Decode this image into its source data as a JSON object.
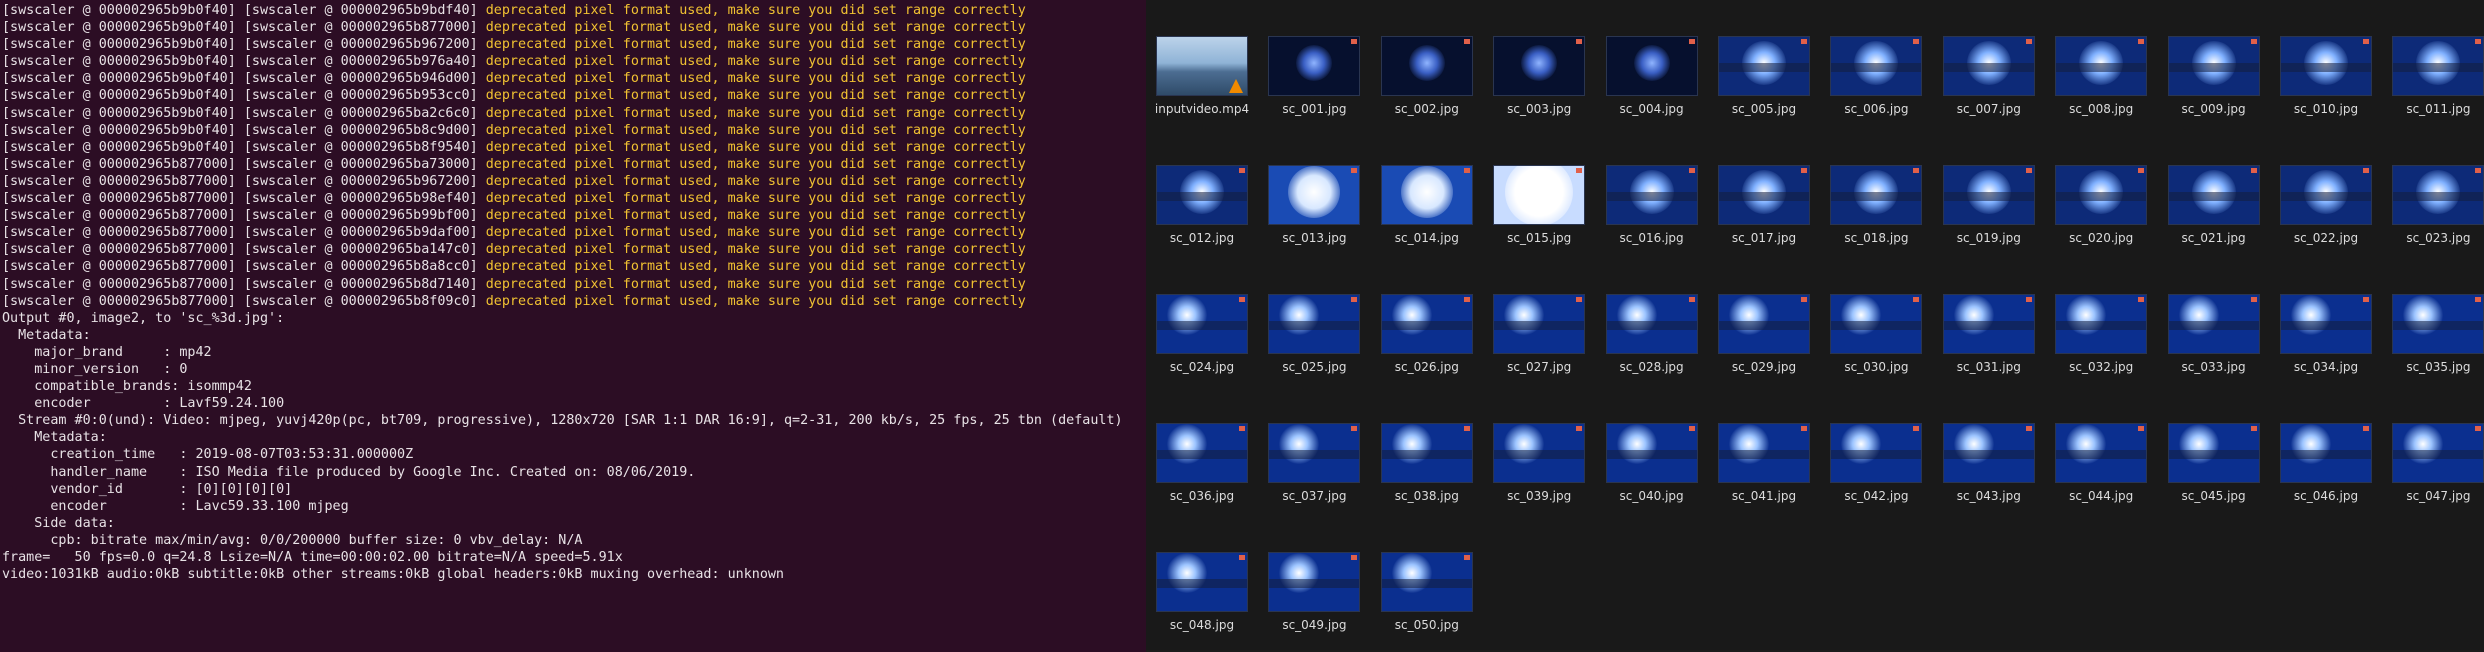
{
  "terminal": {
    "lines": [
      {
        "pre": "[swscaler @ 000002965b9b0f40] [swscaler @ 000002965b9bdf40] ",
        "msg": "deprecated pixel format used, make sure you did set range correctly"
      },
      {
        "pre": "[swscaler @ 000002965b9b0f40] [swscaler @ 000002965b877000] ",
        "msg": "deprecated pixel format used, make sure you did set range correctly"
      },
      {
        "pre": "[swscaler @ 000002965b9b0f40] [swscaler @ 000002965b967200] ",
        "msg": "deprecated pixel format used, make sure you did set range correctly"
      },
      {
        "pre": "[swscaler @ 000002965b9b0f40] [swscaler @ 000002965b976a40] ",
        "msg": "deprecated pixel format used, make sure you did set range correctly"
      },
      {
        "pre": "[swscaler @ 000002965b9b0f40] [swscaler @ 000002965b946d00] ",
        "msg": "deprecated pixel format used, make sure you did set range correctly"
      },
      {
        "pre": "[swscaler @ 000002965b9b0f40] [swscaler @ 000002965b953cc0] ",
        "msg": "deprecated pixel format used, make sure you did set range correctly"
      },
      {
        "pre": "[swscaler @ 000002965b9b0f40] [swscaler @ 000002965ba2c6c0] ",
        "msg": "deprecated pixel format used, make sure you did set range correctly"
      },
      {
        "pre": "[swscaler @ 000002965b9b0f40] [swscaler @ 000002965b8c9d00] ",
        "msg": "deprecated pixel format used, make sure you did set range correctly"
      },
      {
        "pre": "[swscaler @ 000002965b9b0f40] [swscaler @ 000002965b8f9540] ",
        "msg": "deprecated pixel format used, make sure you did set range correctly"
      },
      {
        "pre": "[swscaler @ 000002965b877000] [swscaler @ 000002965ba73000] ",
        "msg": "deprecated pixel format used, make sure you did set range correctly"
      },
      {
        "pre": "[swscaler @ 000002965b877000] [swscaler @ 000002965b967200] ",
        "msg": "deprecated pixel format used, make sure you did set range correctly"
      },
      {
        "pre": "[swscaler @ 000002965b877000] [swscaler @ 000002965b98ef40] ",
        "msg": "deprecated pixel format used, make sure you did set range correctly"
      },
      {
        "pre": "[swscaler @ 000002965b877000] [swscaler @ 000002965b99bf00] ",
        "msg": "deprecated pixel format used, make sure you did set range correctly"
      },
      {
        "pre": "[swscaler @ 000002965b877000] [swscaler @ 000002965b9daf00] ",
        "msg": "deprecated pixel format used, make sure you did set range correctly"
      },
      {
        "pre": "[swscaler @ 000002965b877000] [swscaler @ 000002965ba147c0] ",
        "msg": "deprecated pixel format used, make sure you did set range correctly"
      },
      {
        "pre": "[swscaler @ 000002965b877000] [swscaler @ 000002965b8a8cc0] ",
        "msg": "deprecated pixel format used, make sure you did set range correctly"
      },
      {
        "pre": "[swscaler @ 000002965b877000] [swscaler @ 000002965b8d7140] ",
        "msg": "deprecated pixel format used, make sure you did set range correctly"
      },
      {
        "pre": "[swscaler @ 000002965b877000] [swscaler @ 000002965b8f09c0] ",
        "msg": "deprecated pixel format used, make sure you did set range correctly"
      },
      {
        "pre": "Output #0, image2, to 'sc_%3d.jpg':",
        "msg": ""
      },
      {
        "pre": "  Metadata:",
        "msg": ""
      },
      {
        "pre": "    major_brand     : mp42",
        "msg": ""
      },
      {
        "pre": "    minor_version   : 0",
        "msg": ""
      },
      {
        "pre": "    compatible_brands: isommp42",
        "msg": ""
      },
      {
        "pre": "    encoder         : Lavf59.24.100",
        "msg": ""
      },
      {
        "pre": "  Stream #0:0(und): Video: mjpeg, yuvj420p(pc, bt709, progressive), 1280x720 [SAR 1:1 DAR 16:9], q=2-31, 200 kb/s, 25 fps, 25 tbn (default)",
        "msg": ""
      },
      {
        "pre": "    Metadata:",
        "msg": ""
      },
      {
        "pre": "      creation_time   : 2019-08-07T03:53:31.000000Z",
        "msg": ""
      },
      {
        "pre": "      handler_name    : ISO Media file produced by Google Inc. Created on: 08/06/2019.",
        "msg": ""
      },
      {
        "pre": "      vendor_id       : [0][0][0][0]",
        "msg": ""
      },
      {
        "pre": "      encoder         : Lavc59.33.100 mjpeg",
        "msg": ""
      },
      {
        "pre": "    Side data:",
        "msg": ""
      },
      {
        "pre": "      cpb: bitrate max/min/avg: 0/0/200000 buffer size: 0 vbv_delay: N/A",
        "msg": ""
      },
      {
        "pre": "frame=   50 fps=0.0 q=24.8 Lsize=N/A time=00:00:02.00 bitrate=N/A speed=5.91x",
        "msg": ""
      },
      {
        "pre": "video:1031kB audio:0kB subtitle:0kB other streams:0kB global headers:0kB muxing overhead: unknown",
        "msg": ""
      }
    ]
  },
  "explorer": {
    "files": [
      {
        "name": "inputvideo.mp4",
        "kind": "video"
      },
      {
        "name": "sc_001.jpg",
        "kind": "dark"
      },
      {
        "name": "sc_002.jpg",
        "kind": "dark"
      },
      {
        "name": "sc_003.jpg",
        "kind": "dark"
      },
      {
        "name": "sc_004.jpg",
        "kind": "dark"
      },
      {
        "name": "sc_005.jpg",
        "kind": "mid"
      },
      {
        "name": "sc_006.jpg",
        "kind": "mid"
      },
      {
        "name": "sc_007.jpg",
        "kind": "mid"
      },
      {
        "name": "sc_008.jpg",
        "kind": "mid"
      },
      {
        "name": "sc_009.jpg",
        "kind": "mid"
      },
      {
        "name": "sc_010.jpg",
        "kind": "mid"
      },
      {
        "name": "sc_011.jpg",
        "kind": "mid"
      },
      {
        "name": "sc_012.jpg",
        "kind": "mid"
      },
      {
        "name": "sc_013.jpg",
        "kind": "bright"
      },
      {
        "name": "sc_014.jpg",
        "kind": "bright"
      },
      {
        "name": "sc_015.jpg",
        "kind": "white"
      },
      {
        "name": "sc_016.jpg",
        "kind": "mid"
      },
      {
        "name": "sc_017.jpg",
        "kind": "mid"
      },
      {
        "name": "sc_018.jpg",
        "kind": "mid"
      },
      {
        "name": "sc_019.jpg",
        "kind": "mid"
      },
      {
        "name": "sc_020.jpg",
        "kind": "mid"
      },
      {
        "name": "sc_021.jpg",
        "kind": "mid"
      },
      {
        "name": "sc_022.jpg",
        "kind": "mid"
      },
      {
        "name": "sc_023.jpg",
        "kind": "mid"
      },
      {
        "name": "sc_024.jpg",
        "kind": "panel"
      },
      {
        "name": "sc_025.jpg",
        "kind": "panel"
      },
      {
        "name": "sc_026.jpg",
        "kind": "panel"
      },
      {
        "name": "sc_027.jpg",
        "kind": "panel"
      },
      {
        "name": "sc_028.jpg",
        "kind": "panel"
      },
      {
        "name": "sc_029.jpg",
        "kind": "panel"
      },
      {
        "name": "sc_030.jpg",
        "kind": "panel"
      },
      {
        "name": "sc_031.jpg",
        "kind": "panel"
      },
      {
        "name": "sc_032.jpg",
        "kind": "panel"
      },
      {
        "name": "sc_033.jpg",
        "kind": "panel"
      },
      {
        "name": "sc_034.jpg",
        "kind": "panel"
      },
      {
        "name": "sc_035.jpg",
        "kind": "panel"
      },
      {
        "name": "sc_036.jpg",
        "kind": "panel"
      },
      {
        "name": "sc_037.jpg",
        "kind": "panel"
      },
      {
        "name": "sc_038.jpg",
        "kind": "panel"
      },
      {
        "name": "sc_039.jpg",
        "kind": "panel"
      },
      {
        "name": "sc_040.jpg",
        "kind": "panel"
      },
      {
        "name": "sc_041.jpg",
        "kind": "panel"
      },
      {
        "name": "sc_042.jpg",
        "kind": "panel"
      },
      {
        "name": "sc_043.jpg",
        "kind": "panel"
      },
      {
        "name": "sc_044.jpg",
        "kind": "panel"
      },
      {
        "name": "sc_045.jpg",
        "kind": "panel"
      },
      {
        "name": "sc_046.jpg",
        "kind": "panel"
      },
      {
        "name": "sc_047.jpg",
        "kind": "panel"
      },
      {
        "name": "sc_048.jpg",
        "kind": "panel"
      },
      {
        "name": "sc_049.jpg",
        "kind": "panel"
      },
      {
        "name": "sc_050.jpg",
        "kind": "panel"
      }
    ]
  },
  "colors": {
    "terminal_bg": "#2c0d24",
    "warning": "#f1c232",
    "explorer_bg": "#191919"
  }
}
